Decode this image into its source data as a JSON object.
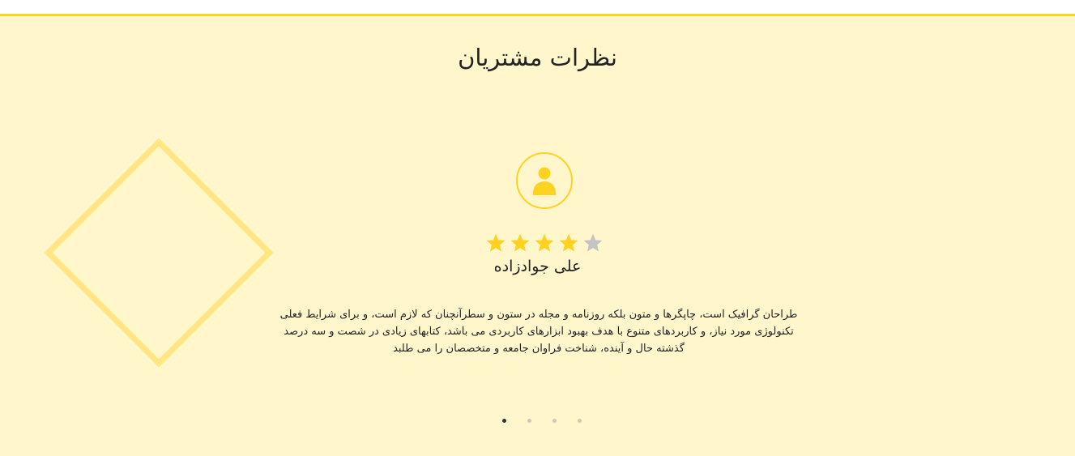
{
  "testimonials": {
    "title": "نظرات مشتریان",
    "rating": 4,
    "rating_max": 5,
    "colors": {
      "accent": "#ffd21f",
      "background": "#fff6cc",
      "star_empty": "#c4c4c4"
    },
    "current": {
      "name": "علی جوادزاده",
      "avatar_icon": "user-icon",
      "text_lines": [
        "طراحان گرافیک است، چاپگرها و متون بلکه روزنامه و مجله در ستون و سطرآنچنان که لازم است، و برای شرایط فعلی",
        "تکنولوژی مورد نیاز، و کاربردهای متنوع با هدف بهبود ابزارهای کاربردی می باشد، کتابهای زیادی در شصت و سه درصد",
        "گذشته حال و آینده، شناخت فراوان جامعه و متخصصان را می طلبد"
      ]
    },
    "slides_count": 4,
    "active_slide": 1
  }
}
